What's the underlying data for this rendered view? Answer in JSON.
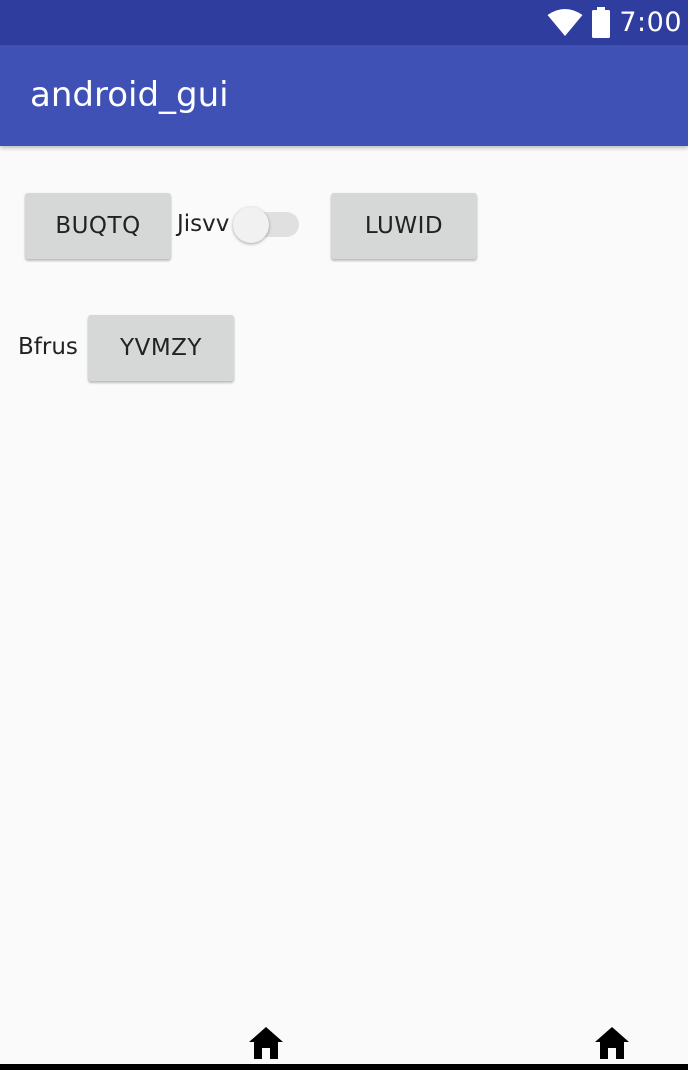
{
  "status_bar": {
    "time": "7:00",
    "icons": [
      "wifi-icon",
      "battery-icon"
    ]
  },
  "app_bar": {
    "title": "android_gui"
  },
  "content": {
    "row1": {
      "button_left": "BUQTQ",
      "switch_label": "Jisvv",
      "switch_checked": false,
      "button_right": "LUWID"
    },
    "row2": {
      "label": "Bfrus",
      "button": "YVMZY"
    }
  },
  "nav": {
    "icons": [
      "home-icon",
      "home-icon"
    ]
  },
  "colors": {
    "status_bar": "#2f3e9e",
    "app_bar": "#3f51b5",
    "background": "#fafafa",
    "button": "#d6d7d7"
  }
}
